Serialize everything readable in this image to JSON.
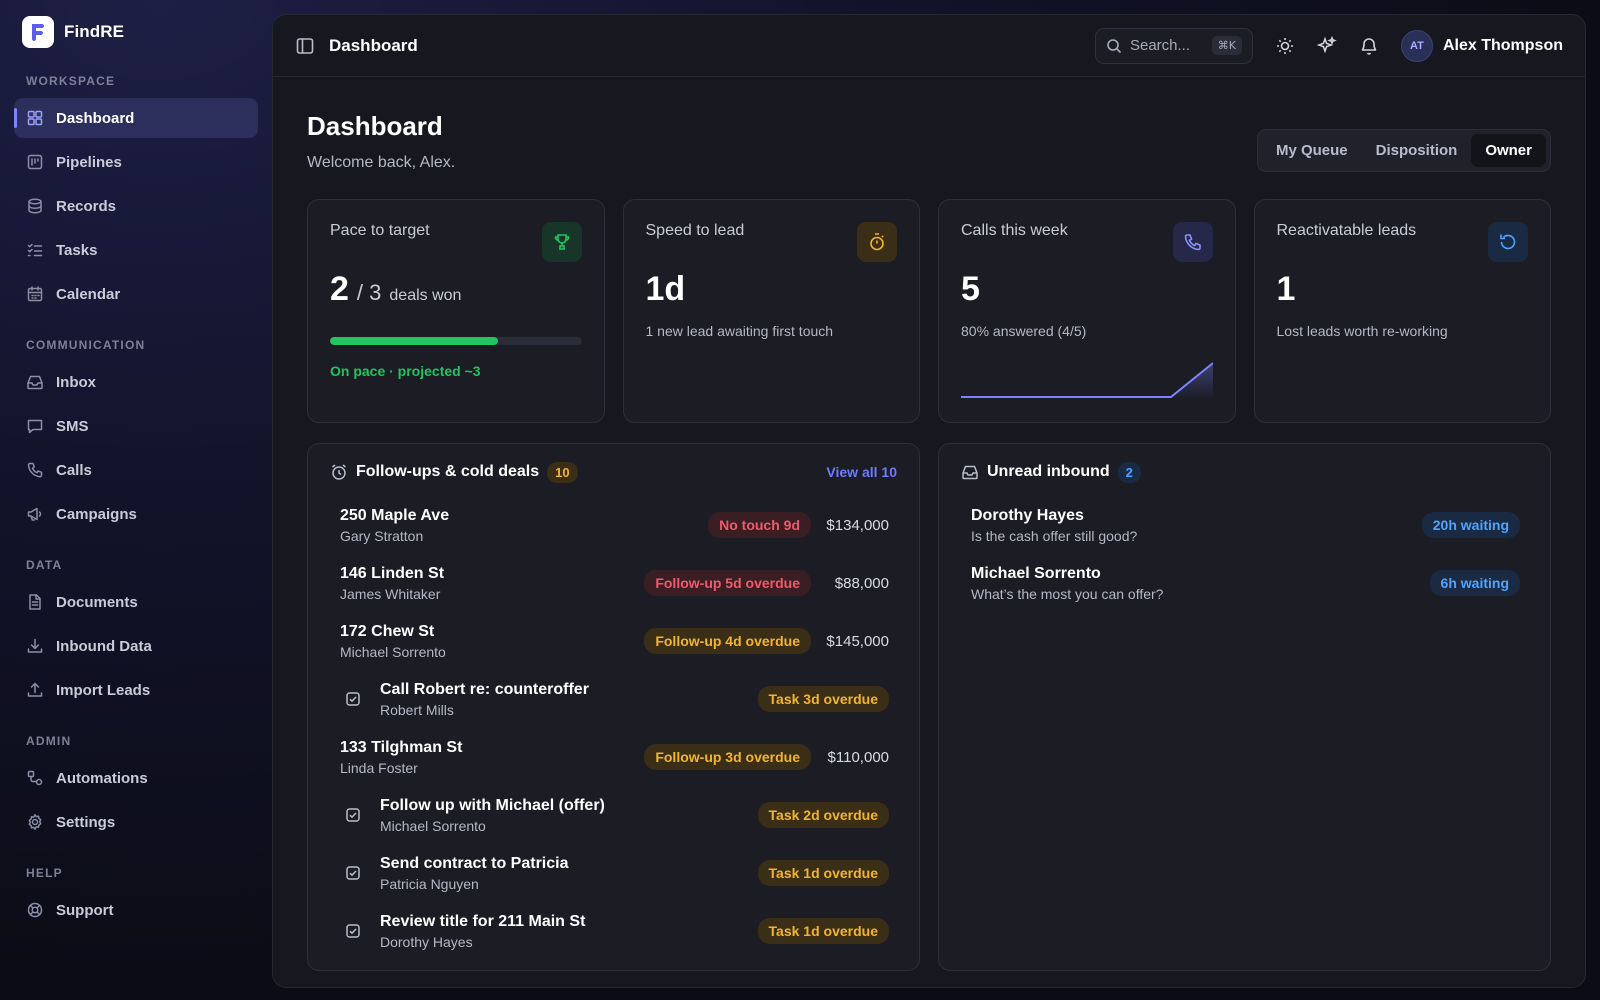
{
  "brand": {
    "name": "FindRE",
    "logo_letter": "F"
  },
  "sidebar": {
    "sections": [
      {
        "label": "WORKSPACE",
        "items": [
          {
            "label": "Dashboard",
            "icon": "grid-icon",
            "active": true
          },
          {
            "label": "Pipelines",
            "icon": "pipeline-icon"
          },
          {
            "label": "Records",
            "icon": "database-icon"
          },
          {
            "label": "Tasks",
            "icon": "list-check-icon"
          },
          {
            "label": "Calendar",
            "icon": "calendar-icon"
          }
        ]
      },
      {
        "label": "COMMUNICATION",
        "items": [
          {
            "label": "Inbox",
            "icon": "inbox-icon"
          },
          {
            "label": "SMS",
            "icon": "message-icon"
          },
          {
            "label": "Calls",
            "icon": "phone-icon"
          },
          {
            "label": "Campaigns",
            "icon": "megaphone-icon"
          }
        ]
      },
      {
        "label": "DATA",
        "items": [
          {
            "label": "Documents",
            "icon": "document-icon"
          },
          {
            "label": "Inbound Data",
            "icon": "download-icon"
          },
          {
            "label": "Import Leads",
            "icon": "upload-icon"
          }
        ]
      },
      {
        "label": "ADMIN",
        "items": [
          {
            "label": "Automations",
            "icon": "workflow-icon"
          },
          {
            "label": "Settings",
            "icon": "gear-icon"
          }
        ]
      },
      {
        "label": "HELP",
        "items": [
          {
            "label": "Support",
            "icon": "lifebuoy-icon"
          }
        ]
      }
    ]
  },
  "topbar": {
    "breadcrumb": "Dashboard",
    "search_placeholder": "Search...",
    "search_shortcut": "⌘K",
    "user_initials": "AT",
    "user_name": "Alex Thompson"
  },
  "page": {
    "title": "Dashboard",
    "subtitle": "Welcome back, Alex.",
    "views": [
      "My Queue",
      "Disposition",
      "Owner"
    ],
    "active_view": "Owner"
  },
  "stats": {
    "pace": {
      "label": "Pace to target",
      "value": "2",
      "target": "3",
      "unit": "deals won",
      "progress_fraction": 0.667,
      "note": "On pace · projected ~3",
      "icon": "trophy-icon",
      "color": "#22c55e"
    },
    "speed": {
      "label": "Speed to lead",
      "value": "1d",
      "note": "1 new lead awaiting first touch",
      "icon": "stopwatch-icon",
      "color": "#f3b42e"
    },
    "calls": {
      "label": "Calls this week",
      "value": "5",
      "note": "80% answered (4/5)",
      "icon": "phone-icon",
      "color": "#7b83ff",
      "daily_calls": [
        0,
        0,
        0,
        0,
        0,
        0,
        5
      ]
    },
    "reactivatable": {
      "label": "Reactivatable leads",
      "value": "1",
      "note": "Lost leads worth re-working",
      "icon": "refresh-icon",
      "color": "#4ea4ff"
    }
  },
  "followups": {
    "title": "Follow-ups & cold deals",
    "count": "10",
    "view_all": "View all 10",
    "rows": [
      {
        "kind": "deal",
        "title": "250 Maple Ave",
        "sub": "Gary Stratton",
        "badge": "No touch 9d",
        "tone": "red",
        "amount": "$134,000"
      },
      {
        "kind": "deal",
        "title": "146 Linden St",
        "sub": "James Whitaker",
        "badge": "Follow-up 5d overdue",
        "tone": "red",
        "amount": "$88,000"
      },
      {
        "kind": "deal",
        "title": "172 Chew St",
        "sub": "Michael Sorrento",
        "badge": "Follow-up 4d overdue",
        "tone": "amber",
        "amount": "$145,000"
      },
      {
        "kind": "task",
        "title": "Call Robert re: counteroffer",
        "sub": "Robert Mills",
        "badge": "Task 3d overdue",
        "tone": "amber",
        "amount": ""
      },
      {
        "kind": "deal",
        "title": "133 Tilghman St",
        "sub": "Linda Foster",
        "badge": "Follow-up 3d overdue",
        "tone": "amber",
        "amount": "$110,000"
      },
      {
        "kind": "task",
        "title": "Follow up with Michael (offer)",
        "sub": "Michael Sorrento",
        "badge": "Task 2d overdue",
        "tone": "amber",
        "amount": ""
      },
      {
        "kind": "task",
        "title": "Send contract to Patricia",
        "sub": "Patricia Nguyen",
        "badge": "Task 1d overdue",
        "tone": "amber",
        "amount": ""
      },
      {
        "kind": "task",
        "title": "Review title for 211 Main St",
        "sub": "Dorothy Hayes",
        "badge": "Task 1d overdue",
        "tone": "amber",
        "amount": ""
      }
    ]
  },
  "inbound": {
    "title": "Unread inbound",
    "count": "2",
    "rows": [
      {
        "name": "Dorothy Hayes",
        "message": "Is the cash offer still good?",
        "badge": "20h waiting"
      },
      {
        "name": "Michael Sorrento",
        "message": "What’s the most you can offer?",
        "badge": "6h waiting"
      }
    ]
  }
}
